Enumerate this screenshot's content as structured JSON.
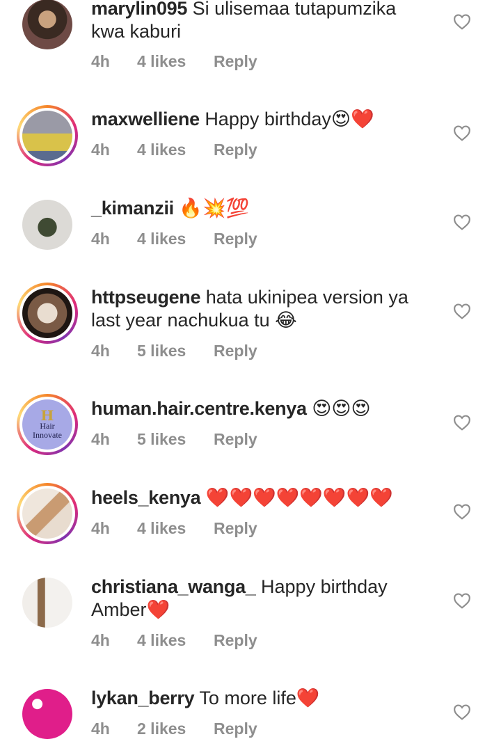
{
  "comments": [
    {
      "username": "marylin095",
      "text": "Si ulisemaa tutapumzika kwa kaburi",
      "time": "4h",
      "likes": "4 likes",
      "reply": "Reply",
      "avatar_ring": false
    },
    {
      "username": "maxwelliene",
      "text": "Happy birthday😍❤️",
      "time": "4h",
      "likes": "4 likes",
      "reply": "Reply",
      "avatar_ring": true
    },
    {
      "username": "_kimanzii",
      "text": "🔥💥💯",
      "time": "4h",
      "likes": "4 likes",
      "reply": "Reply",
      "avatar_ring": false
    },
    {
      "username": "httpseugene",
      "text": "hata ukinipea version ya last year nachukua tu 😂",
      "time": "4h",
      "likes": "5 likes",
      "reply": "Reply",
      "avatar_ring": true
    },
    {
      "username": "human.hair.centre.kenya",
      "text": "😍😍😍",
      "time": "4h",
      "likes": "5 likes",
      "reply": "Reply",
      "avatar_ring": true,
      "avatar_text": [
        "Hair",
        "Innovate"
      ]
    },
    {
      "username": "heels_kenya",
      "text": "❤️❤️❤️❤️❤️❤️❤️❤️",
      "time": "4h",
      "likes": "4 likes",
      "reply": "Reply",
      "avatar_ring": true
    },
    {
      "username": "christiana_wanga_",
      "text": "Happy birthday Amber❤️",
      "time": "4h",
      "likes": "4 likes",
      "reply": "Reply",
      "avatar_ring": false
    },
    {
      "username": "lykan_berry",
      "text": "To more life❤️",
      "time": "4h",
      "likes": "2 likes",
      "reply": "Reply",
      "avatar_ring": false
    }
  ],
  "colors": {
    "text": "#262626",
    "meta": "#8e8e8e",
    "heart_outline": "#8e8e8e",
    "emoji_heart": "#e0212b"
  },
  "icons": {
    "like": "heart-outline-icon"
  }
}
